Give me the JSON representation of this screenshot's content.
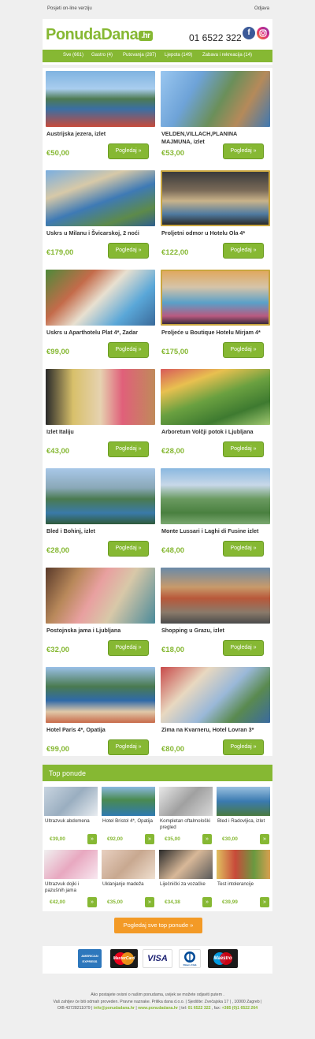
{
  "topbar": {
    "online_link": "Posjeti on-line verziju",
    "logout": "Odjava"
  },
  "header": {
    "logo_main": "PonudaDana",
    "logo_hr": ".hr",
    "phone": "01 6522 322"
  },
  "nav": [
    "Sve (661)",
    "Gastro (4)",
    "Putovanja (287)",
    "Ljepota (149)",
    "Zabava i rekreacija (14)"
  ],
  "offers": [
    {
      "title": "Austrijska jezera, izlet",
      "price": "€50,00",
      "button": "Pogledaj »"
    },
    {
      "title": "VELDEN,VILLACH,PLANINA MAJMUNA, izlet",
      "price": "€53,00",
      "button": "Pogledaj »"
    },
    {
      "title": "Uskrs u Milanu i Švicarskoj, 2 noći",
      "price": "€179,00",
      "button": "Pogledaj »"
    },
    {
      "title": "Proljetni odmor u Hotelu Ola 4*",
      "price": "€122,00",
      "button": "Pogledaj »"
    },
    {
      "title": "Uskrs u Aparthotelu Plat 4*, Zadar",
      "price": "€99,00",
      "button": "Pogledaj »"
    },
    {
      "title": "Proljeće u Boutique Hotelu Mirjam 4*",
      "price": "€175,00",
      "button": "Pogledaj »"
    },
    {
      "title": "Izlet Italiju",
      "price": "€43,00",
      "button": "Pogledaj »"
    },
    {
      "title": "Arboretum Volčji potok i Ljubljana",
      "price": "€28,00",
      "button": "Pogledaj »"
    },
    {
      "title": "Bled i Bohinj, izlet",
      "price": "€28,00",
      "button": "Pogledaj »"
    },
    {
      "title": "Monte Lussari i Laghi di Fusine izlet",
      "price": "€48,00",
      "button": "Pogledaj »"
    },
    {
      "title": "Postojnska jama i Ljubljana",
      "price": "€32,00",
      "button": "Pogledaj »"
    },
    {
      "title": "Shopping u Grazu, izlet",
      "price": "€18,00",
      "button": "Pogledaj »"
    },
    {
      "title": "Hotel Paris 4*, Opatija",
      "price": "€99,00",
      "button": "Pogledaj »"
    },
    {
      "title": "Zima na Kvarneru, Hotel Lovran 3*",
      "price": "€80,00",
      "button": "Pogledaj »"
    }
  ],
  "top_offers": {
    "heading": "Top ponude",
    "items": [
      {
        "name": "Ultrazvuk abdomena",
        "price": "€39,00"
      },
      {
        "name": "Hotel Bristol 4*, Opatija",
        "price": "€92,00"
      },
      {
        "name": "Kompletan oftalmološki pregled",
        "price": "€35,00"
      },
      {
        "name": "Bled i Radovljica, izlet",
        "price": "€30,00"
      },
      {
        "name": "Ultrazvuk dojki i pazušnih jama",
        "price": "€42,00"
      },
      {
        "name": "Uklanjanje madeža",
        "price": "€35,00"
      },
      {
        "name": "Liječnički za vozačke",
        "price": "€34,38"
      },
      {
        "name": "Test intolerancije",
        "price": "€39,99"
      }
    ],
    "arrow": "»",
    "see_all": "Pogledaj sve top ponude »"
  },
  "payments": [
    "AMERICAN EXPRESS",
    "MasterCard",
    "VISA",
    "Diners Club",
    "Maestro"
  ],
  "footer": {
    "line1": "Ako postajete ovisni o našim ponudama, uvijek se možete odjaviti putem .",
    "line2": "Vaš zahtjev će biti odmah proveden. Pravne naznake. Prilika dana d.o.o. | Sjedište: Zvečajska 17 | , 10000 Zagreb |",
    "line3a": "OIB 43728211079 |",
    "email": "info@ponudadana.hr",
    "sep1": "|",
    "site": "www.ponudadana.hr",
    "tel_label": "| tel:",
    "tel": "01 6522 322",
    "fax_label": ", fax:",
    "fax": "+385 (0)1 6522 264"
  },
  "colors": {
    "brand_green": "#86b833",
    "orange": "#f39a26",
    "background": "#efefef"
  }
}
